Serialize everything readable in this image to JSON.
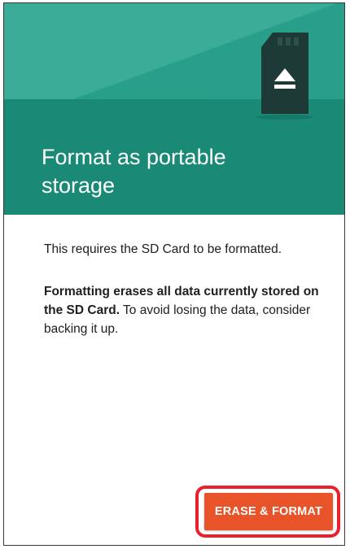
{
  "dialog": {
    "title": "Format as portable storage",
    "message_line1": "This requires the SD Card to be formatted.",
    "warning_bold": "Formatting erases all data currently stored on the SD Card.",
    "warning_rest": " To avoid losing the data, consider backing it up.",
    "primary_button_label": "ERASE & FORMAT"
  },
  "icons": {
    "header_icon": "sd-card-eject-icon"
  },
  "colors": {
    "header_light": "#2aa58f",
    "header_dark": "#1a8a76",
    "button": "#e8532a",
    "highlight_border": "#e8212b"
  }
}
